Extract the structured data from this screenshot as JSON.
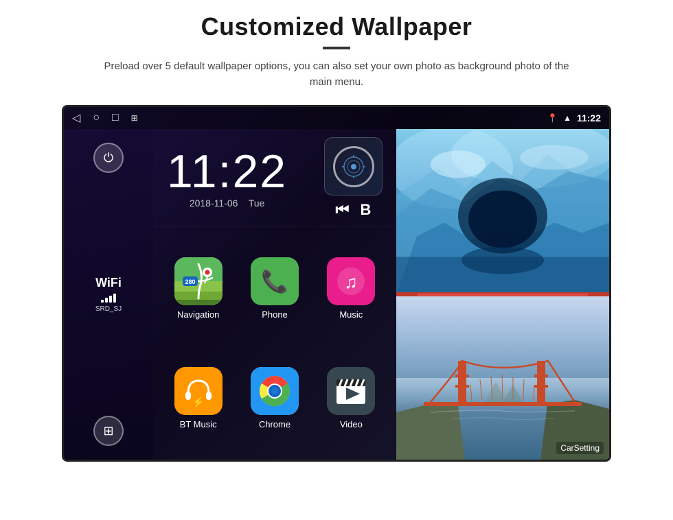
{
  "header": {
    "title": "Customized Wallpaper",
    "divider": true,
    "subtitle": "Preload over 5 default wallpaper options, you can also set your own photo as background photo of the main menu."
  },
  "android_ui": {
    "status_bar": {
      "time": "11:22",
      "nav_icons": [
        "◁",
        "○",
        "□",
        "⊞"
      ],
      "right_icons": [
        "location",
        "wifi",
        "time"
      ]
    },
    "clock": {
      "time": "11:22",
      "date": "2018-11-06",
      "day": "Tue"
    },
    "wifi": {
      "label": "WiFi",
      "network": "SRD_SJ"
    },
    "apps": [
      {
        "name": "Navigation",
        "icon": "nav"
      },
      {
        "name": "Phone",
        "icon": "phone"
      },
      {
        "name": "Music",
        "icon": "music"
      },
      {
        "name": "BT Music",
        "icon": "bt"
      },
      {
        "name": "Chrome",
        "icon": "chrome"
      },
      {
        "name": "Video",
        "icon": "video"
      }
    ],
    "wallpapers": [
      {
        "name": "Ice Cave",
        "type": "ice"
      },
      {
        "name": "Golden Gate Bridge",
        "type": "bridge"
      }
    ],
    "car_setting_label": "CarSetting"
  }
}
